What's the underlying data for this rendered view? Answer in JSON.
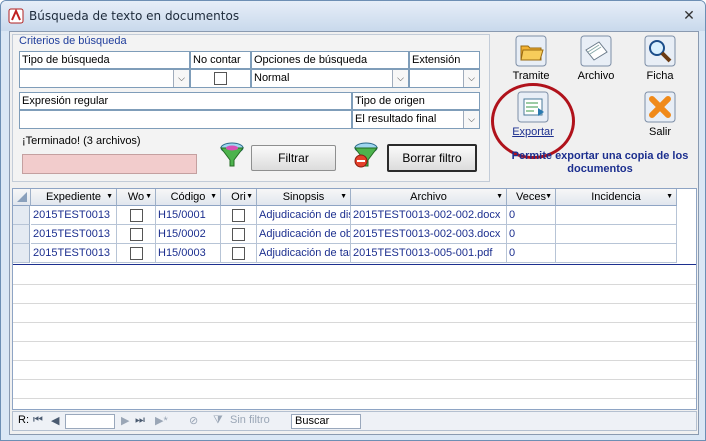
{
  "window": {
    "title": "Búsqueda de texto en documentos",
    "close_glyph": "✕"
  },
  "criteria": {
    "group_title": "Criterios de búsqueda",
    "tipo_label": "Tipo de búsqueda",
    "tipo_value": "",
    "no_contar_label": "No contar",
    "opciones_label": "Opciones de búsqueda",
    "opciones_value": "Normal",
    "extension_label": "Extensión",
    "extension_value": "",
    "expresion_label": "Expresión regular",
    "expresion_value": "",
    "origen_label": "Tipo de origen",
    "origen_value": "El resultado final",
    "status": "¡Terminado! (3 archivos)",
    "filtrar_label": "Filtrar",
    "borrar_label": "Borrar filtro"
  },
  "toolbar": {
    "tramite": "Tramite",
    "archivo": "Archivo",
    "ficha": "Ficha",
    "exportar": "Exportar",
    "salir": "Salir",
    "tip": "Permite exportar una copia de los documentos"
  },
  "grid": {
    "columns": [
      "Expediente",
      "Wo",
      "Código",
      "Ori",
      "Sinopsis",
      "Archivo",
      "Veces",
      "Incidencia"
    ],
    "rows": [
      {
        "expediente": "2015TEST0013",
        "codigo": "H15/0001",
        "sinopsis": "Adjudicación de dis",
        "archivo": "2015TEST0013-002-002.docx",
        "veces": "0",
        "incidencia": ""
      },
      {
        "expediente": "2015TEST0013",
        "codigo": "H15/0002",
        "sinopsis": "Adjudicación de ob",
        "archivo": "2015TEST0013-002-003.docx",
        "veces": "0",
        "incidencia": ""
      },
      {
        "expediente": "2015TEST0013",
        "codigo": "H15/0003",
        "sinopsis": "Adjudicación de tar",
        "archivo": "2015TEST0013-005-001.pdf",
        "veces": "0",
        "incidencia": ""
      }
    ]
  },
  "nav": {
    "record_label": "R:",
    "no_filter": "Sin filtro",
    "search": "Buscar"
  },
  "colors": {
    "accent": "#1c2f8f",
    "highlight_ring": "#b0121b",
    "progress": "#f2cccc"
  }
}
